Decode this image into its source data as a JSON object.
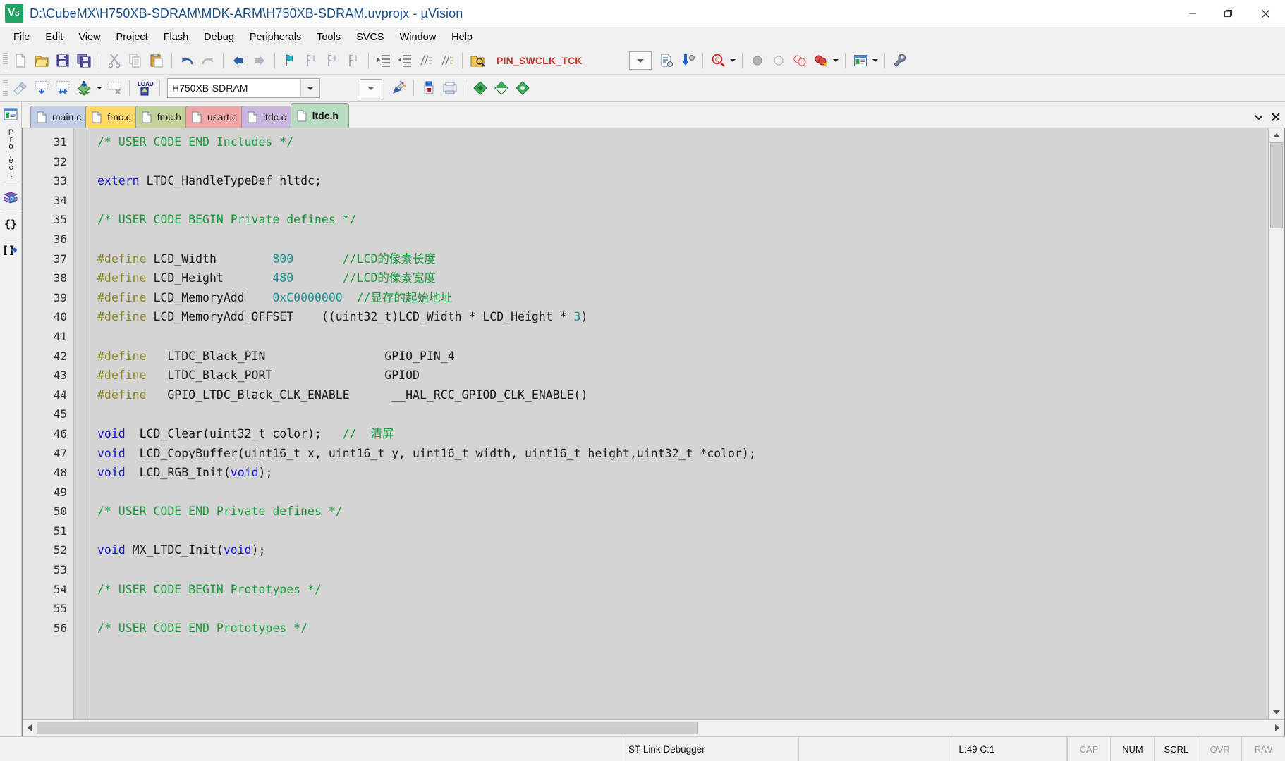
{
  "window": {
    "title": "D:\\CubeMX\\H750XB-SDRAM\\MDK-ARM\\H750XB-SDRAM.uvprojx - µVision",
    "app_icon": "uvision-logo-icon",
    "minimize": "─",
    "maximize": "❐",
    "close": "✕"
  },
  "menu": {
    "items": [
      {
        "label": "File"
      },
      {
        "label": "Edit"
      },
      {
        "label": "View"
      },
      {
        "label": "Project"
      },
      {
        "label": "Flash"
      },
      {
        "label": "Debug"
      },
      {
        "label": "Peripherals"
      },
      {
        "label": "Tools"
      },
      {
        "label": "SVCS"
      },
      {
        "label": "Window"
      },
      {
        "label": "Help"
      }
    ]
  },
  "toolbar_main": {
    "find_value": "PIN_SWCLK_TCK",
    "icons": [
      "new-file-icon",
      "open-file-icon",
      "save-icon",
      "save-all-icon",
      "cut-icon",
      "copy-icon",
      "paste-icon",
      "undo-icon",
      "redo-icon",
      "navigate-back-icon",
      "navigate-forward-icon",
      "bookmark-toggle-icon",
      "bookmark-prev-icon",
      "bookmark-next-icon",
      "bookmark-clear-icon",
      "indent-icon",
      "outdent-icon",
      "comment-icon",
      "uncomment-icon",
      "find-in-files-icon"
    ],
    "right_icons": [
      "combo-dropdown-icon",
      "configure-file-icon",
      "debug-insert-icon",
      "magnifier-icon",
      "dropdown-caret-icon",
      "breakpoint-gray-icon",
      "breakpoint-hollow-icon",
      "breakpoint-disable-icon",
      "breakpoint-kill-icon",
      "dropdown-caret-icon",
      "window-manager-icon",
      "dropdown-caret-icon",
      "configure-wrench-icon"
    ]
  },
  "toolbar_build": {
    "target_value": "H750XB-SDRAM",
    "icons": [
      "translate-icon",
      "build-file-icon",
      "build-target-icon",
      "rebuild-icon",
      "batch-build-caret-icon",
      "stop-build-icon",
      "load-icon"
    ],
    "right_icons": [
      "combo-dropdown-icon",
      "target-options-icon",
      "manage-project-icon",
      "manage-multi-icon",
      "pack-installer-icon",
      "pack-manager-icon",
      "pack-icon"
    ]
  },
  "tabs": {
    "items": [
      {
        "label": "main.c",
        "color": "#c2cfe8",
        "active": false
      },
      {
        "label": "fmc.c",
        "color": "#ffd966",
        "active": false
      },
      {
        "label": "fmc.h",
        "color": "#c3d39a",
        "active": false
      },
      {
        "label": "usart.c",
        "color": "#efa6a6",
        "active": false
      },
      {
        "label": "ltdc.c",
        "color": "#c9b5dd",
        "active": false
      },
      {
        "label": "ltdc.h",
        "color": "#b9dcc0",
        "active": true
      }
    ],
    "overflow_icon": "chevron-down-icon",
    "close_icon": "close-icon"
  },
  "sidebar": {
    "items": [
      {
        "icon": "project-window-icon",
        "label": "Project"
      },
      {
        "icon": "books-help-icon",
        "label": ""
      },
      {
        "icon": "functions-icon",
        "label": "{}"
      },
      {
        "icon": "templates-icon",
        "label": "[]→"
      }
    ]
  },
  "editor": {
    "first_line": 31,
    "lines": [
      {
        "n": 31,
        "tokens": [
          {
            "t": "/* USER CODE END Includes */",
            "c": "cmt"
          }
        ]
      },
      {
        "n": 32,
        "tokens": []
      },
      {
        "n": 33,
        "tokens": [
          {
            "t": "extern",
            "c": "kw"
          },
          {
            "t": " LTDC_HandleTypeDef hltdc;",
            "c": ""
          }
        ]
      },
      {
        "n": 34,
        "tokens": []
      },
      {
        "n": 35,
        "tokens": [
          {
            "t": "/* USER CODE BEGIN Private defines */",
            "c": "cmt"
          }
        ]
      },
      {
        "n": 36,
        "tokens": []
      },
      {
        "n": 37,
        "tokens": [
          {
            "t": "#define",
            "c": "pp"
          },
          {
            "t": " LCD_Width        ",
            "c": ""
          },
          {
            "t": "800",
            "c": "num"
          },
          {
            "t": "       ",
            "c": ""
          },
          {
            "t": "//LCD的像素长度",
            "c": "cmt"
          }
        ]
      },
      {
        "n": 38,
        "tokens": [
          {
            "t": "#define",
            "c": "pp"
          },
          {
            "t": " LCD_Height       ",
            "c": ""
          },
          {
            "t": "480",
            "c": "num"
          },
          {
            "t": "       ",
            "c": ""
          },
          {
            "t": "//LCD的像素宽度",
            "c": "cmt"
          }
        ]
      },
      {
        "n": 39,
        "tokens": [
          {
            "t": "#define",
            "c": "pp"
          },
          {
            "t": " LCD_MemoryAdd    ",
            "c": ""
          },
          {
            "t": "0xC0000000",
            "c": "num"
          },
          {
            "t": "  ",
            "c": ""
          },
          {
            "t": "//显存的起始地址",
            "c": "cmt"
          }
        ]
      },
      {
        "n": 40,
        "tokens": [
          {
            "t": "#define",
            "c": "pp"
          },
          {
            "t": " LCD_MemoryAdd_OFFSET    ((uint32_t)LCD_Width * LCD_Height * ",
            "c": ""
          },
          {
            "t": "3",
            "c": "num"
          },
          {
            "t": ")",
            "c": ""
          }
        ]
      },
      {
        "n": 41,
        "tokens": []
      },
      {
        "n": 42,
        "tokens": [
          {
            "t": "#define",
            "c": "pp"
          },
          {
            "t": "   LTDC_Black_PIN                 GPIO_PIN_4",
            "c": ""
          }
        ]
      },
      {
        "n": 43,
        "tokens": [
          {
            "t": "#define",
            "c": "pp"
          },
          {
            "t": "   LTDC_Black_PORT                GPIOD",
            "c": ""
          }
        ]
      },
      {
        "n": 44,
        "tokens": [
          {
            "t": "#define",
            "c": "pp"
          },
          {
            "t": "   GPIO_LTDC_Black_CLK_ENABLE      __HAL_RCC_GPIOD_CLK_ENABLE()",
            "c": ""
          }
        ]
      },
      {
        "n": 45,
        "tokens": []
      },
      {
        "n": 46,
        "tokens": [
          {
            "t": "void",
            "c": "kw"
          },
          {
            "t": "  LCD_Clear(uint32_t color);   ",
            "c": ""
          },
          {
            "t": "//  清屏",
            "c": "cmt"
          }
        ]
      },
      {
        "n": 47,
        "tokens": [
          {
            "t": "void",
            "c": "kw"
          },
          {
            "t": "  LCD_CopyBuffer(uint16_t x, uint16_t y, uint16_t width, uint16_t height,uint32_t *color);",
            "c": ""
          }
        ]
      },
      {
        "n": 48,
        "tokens": [
          {
            "t": "void",
            "c": "kw"
          },
          {
            "t": "  LCD_RGB_Init(",
            "c": ""
          },
          {
            "t": "void",
            "c": "kw"
          },
          {
            "t": ");",
            "c": ""
          }
        ]
      },
      {
        "n": 49,
        "tokens": []
      },
      {
        "n": 50,
        "tokens": [
          {
            "t": "/* USER CODE END Private defines */",
            "c": "cmt"
          }
        ]
      },
      {
        "n": 51,
        "tokens": []
      },
      {
        "n": 52,
        "tokens": [
          {
            "t": "void",
            "c": "kw"
          },
          {
            "t": " MX_LTDC_Init(",
            "c": ""
          },
          {
            "t": "void",
            "c": "kw"
          },
          {
            "t": ");",
            "c": ""
          }
        ]
      },
      {
        "n": 53,
        "tokens": []
      },
      {
        "n": 54,
        "tokens": [
          {
            "t": "/* USER CODE BEGIN Prototypes */",
            "c": "cmt"
          }
        ]
      },
      {
        "n": 55,
        "tokens": []
      },
      {
        "n": 56,
        "tokens": [
          {
            "t": "/* USER CODE END Prototypes */",
            "c": "cmt"
          }
        ]
      }
    ]
  },
  "statusbar": {
    "debugger": "ST-Link Debugger",
    "position": "L:49 C:1",
    "indicators": [
      {
        "label": "CAP",
        "on": false
      },
      {
        "label": "NUM",
        "on": true
      },
      {
        "label": "SCRL",
        "on": true
      },
      {
        "label": "OVR",
        "on": false
      },
      {
        "label": "R/W",
        "on": false
      }
    ]
  },
  "colors": {
    "comment": "#1a9a3c",
    "keyword": "#1414d6",
    "preprocessor": "#8a8a1e",
    "number": "#1d9191",
    "editor_bg": "#d4d4d4",
    "title_text": "#1a4f8a",
    "find_text": "#c0392b"
  }
}
